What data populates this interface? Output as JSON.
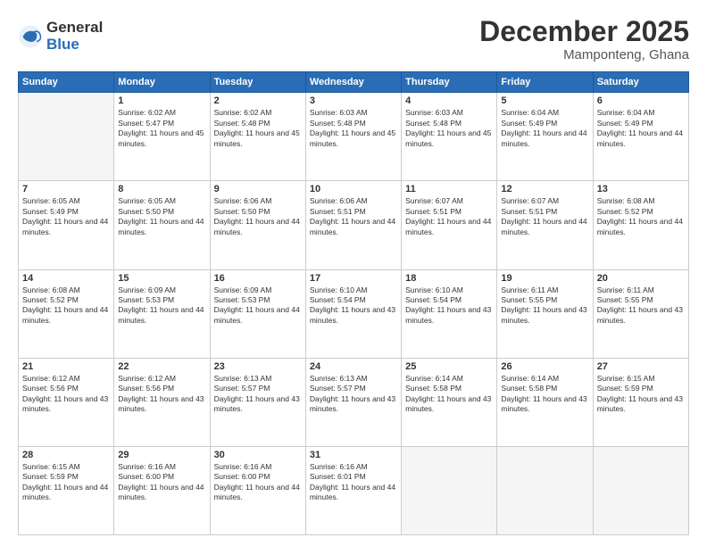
{
  "logo": {
    "general": "General",
    "blue": "Blue"
  },
  "header": {
    "month": "December 2025",
    "location": "Mamponteng, Ghana"
  },
  "days_of_week": [
    "Sunday",
    "Monday",
    "Tuesday",
    "Wednesday",
    "Thursday",
    "Friday",
    "Saturday"
  ],
  "weeks": [
    [
      {
        "day": "",
        "empty": true
      },
      {
        "day": "1",
        "sunrise": "6:02 AM",
        "sunset": "5:47 PM",
        "daylight": "11 hours and 45 minutes."
      },
      {
        "day": "2",
        "sunrise": "6:02 AM",
        "sunset": "5:48 PM",
        "daylight": "11 hours and 45 minutes."
      },
      {
        "day": "3",
        "sunrise": "6:03 AM",
        "sunset": "5:48 PM",
        "daylight": "11 hours and 45 minutes."
      },
      {
        "day": "4",
        "sunrise": "6:03 AM",
        "sunset": "5:48 PM",
        "daylight": "11 hours and 45 minutes."
      },
      {
        "day": "5",
        "sunrise": "6:04 AM",
        "sunset": "5:49 PM",
        "daylight": "11 hours and 44 minutes."
      },
      {
        "day": "6",
        "sunrise": "6:04 AM",
        "sunset": "5:49 PM",
        "daylight": "11 hours and 44 minutes."
      }
    ],
    [
      {
        "day": "7",
        "sunrise": "6:05 AM",
        "sunset": "5:49 PM",
        "daylight": "11 hours and 44 minutes."
      },
      {
        "day": "8",
        "sunrise": "6:05 AM",
        "sunset": "5:50 PM",
        "daylight": "11 hours and 44 minutes."
      },
      {
        "day": "9",
        "sunrise": "6:06 AM",
        "sunset": "5:50 PM",
        "daylight": "11 hours and 44 minutes."
      },
      {
        "day": "10",
        "sunrise": "6:06 AM",
        "sunset": "5:51 PM",
        "daylight": "11 hours and 44 minutes."
      },
      {
        "day": "11",
        "sunrise": "6:07 AM",
        "sunset": "5:51 PM",
        "daylight": "11 hours and 44 minutes."
      },
      {
        "day": "12",
        "sunrise": "6:07 AM",
        "sunset": "5:51 PM",
        "daylight": "11 hours and 44 minutes."
      },
      {
        "day": "13",
        "sunrise": "6:08 AM",
        "sunset": "5:52 PM",
        "daylight": "11 hours and 44 minutes."
      }
    ],
    [
      {
        "day": "14",
        "sunrise": "6:08 AM",
        "sunset": "5:52 PM",
        "daylight": "11 hours and 44 minutes."
      },
      {
        "day": "15",
        "sunrise": "6:09 AM",
        "sunset": "5:53 PM",
        "daylight": "11 hours and 44 minutes."
      },
      {
        "day": "16",
        "sunrise": "6:09 AM",
        "sunset": "5:53 PM",
        "daylight": "11 hours and 44 minutes."
      },
      {
        "day": "17",
        "sunrise": "6:10 AM",
        "sunset": "5:54 PM",
        "daylight": "11 hours and 43 minutes."
      },
      {
        "day": "18",
        "sunrise": "6:10 AM",
        "sunset": "5:54 PM",
        "daylight": "11 hours and 43 minutes."
      },
      {
        "day": "19",
        "sunrise": "6:11 AM",
        "sunset": "5:55 PM",
        "daylight": "11 hours and 43 minutes."
      },
      {
        "day": "20",
        "sunrise": "6:11 AM",
        "sunset": "5:55 PM",
        "daylight": "11 hours and 43 minutes."
      }
    ],
    [
      {
        "day": "21",
        "sunrise": "6:12 AM",
        "sunset": "5:56 PM",
        "daylight": "11 hours and 43 minutes."
      },
      {
        "day": "22",
        "sunrise": "6:12 AM",
        "sunset": "5:56 PM",
        "daylight": "11 hours and 43 minutes."
      },
      {
        "day": "23",
        "sunrise": "6:13 AM",
        "sunset": "5:57 PM",
        "daylight": "11 hours and 43 minutes."
      },
      {
        "day": "24",
        "sunrise": "6:13 AM",
        "sunset": "5:57 PM",
        "daylight": "11 hours and 43 minutes."
      },
      {
        "day": "25",
        "sunrise": "6:14 AM",
        "sunset": "5:58 PM",
        "daylight": "11 hours and 43 minutes."
      },
      {
        "day": "26",
        "sunrise": "6:14 AM",
        "sunset": "5:58 PM",
        "daylight": "11 hours and 43 minutes."
      },
      {
        "day": "27",
        "sunrise": "6:15 AM",
        "sunset": "5:59 PM",
        "daylight": "11 hours and 43 minutes."
      }
    ],
    [
      {
        "day": "28",
        "sunrise": "6:15 AM",
        "sunset": "5:59 PM",
        "daylight": "11 hours and 44 minutes."
      },
      {
        "day": "29",
        "sunrise": "6:16 AM",
        "sunset": "6:00 PM",
        "daylight": "11 hours and 44 minutes."
      },
      {
        "day": "30",
        "sunrise": "6:16 AM",
        "sunset": "6:00 PM",
        "daylight": "11 hours and 44 minutes."
      },
      {
        "day": "31",
        "sunrise": "6:16 AM",
        "sunset": "6:01 PM",
        "daylight": "11 hours and 44 minutes."
      },
      {
        "day": "",
        "empty": true
      },
      {
        "day": "",
        "empty": true
      },
      {
        "day": "",
        "empty": true
      }
    ]
  ]
}
